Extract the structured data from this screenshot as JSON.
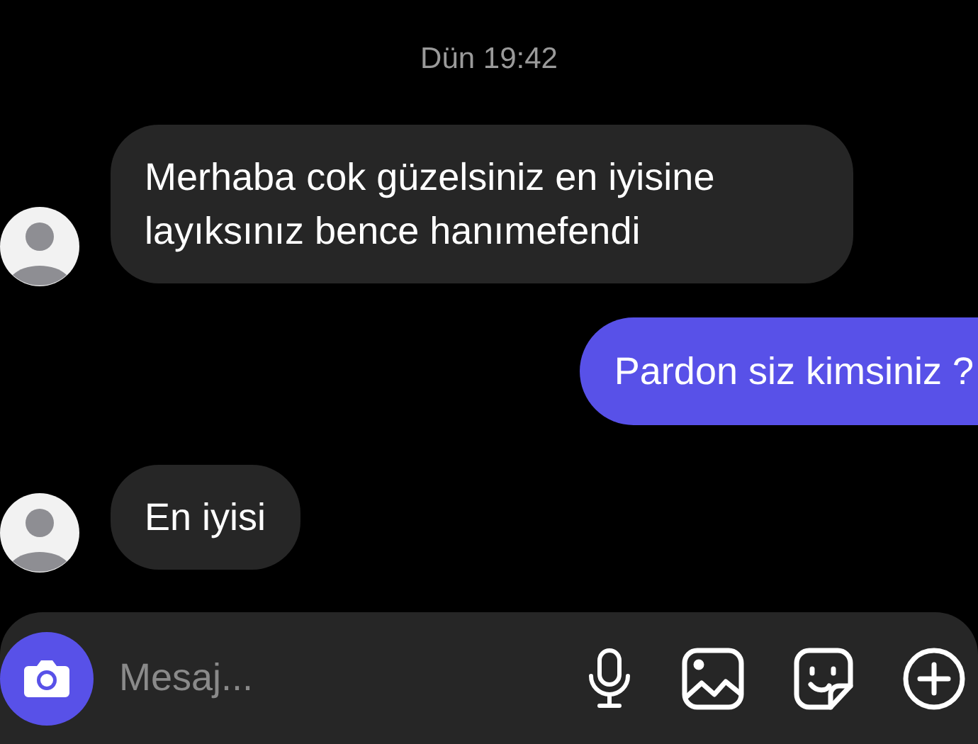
{
  "timestamp": "Dün 19:42",
  "messages": [
    {
      "kind": "received",
      "text": "Merhaba cok güzelsiniz en iyisine layıksınız bence hanımefendi"
    },
    {
      "kind": "sent",
      "text": "Pardon siz kimsiniz ?"
    },
    {
      "kind": "received",
      "text": "En iyisi"
    }
  ],
  "composer": {
    "placeholder": "Mesaj..."
  }
}
